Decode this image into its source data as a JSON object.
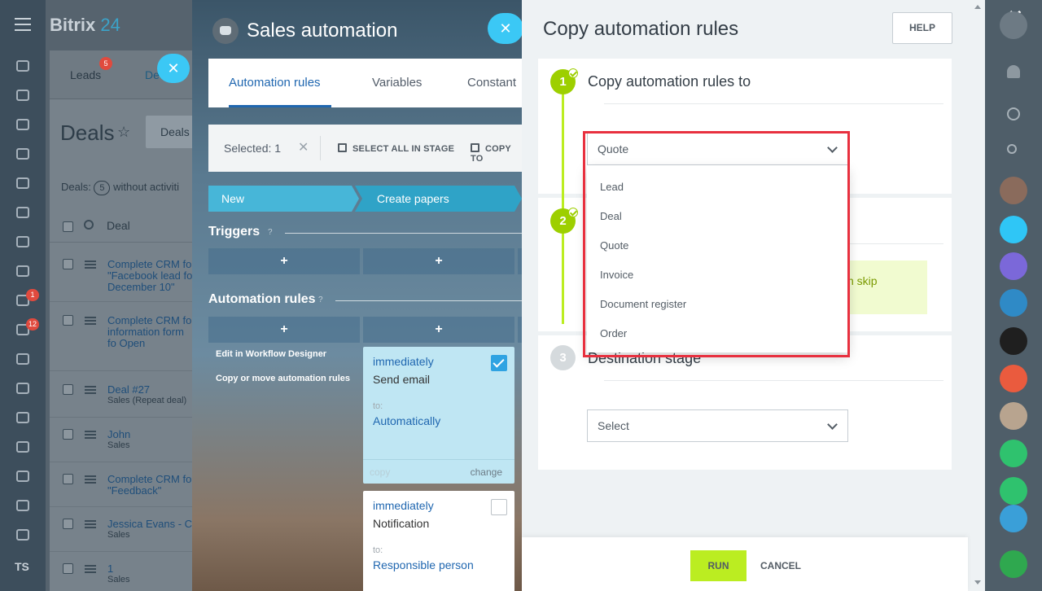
{
  "app": {
    "name": "Bitrix",
    "name_suffix": "24"
  },
  "crm": {
    "tabs": [
      {
        "label": "Leads",
        "badge": "5"
      },
      {
        "label": "De"
      }
    ],
    "page_title": "Deals",
    "filter_button": "Deals",
    "summary": {
      "prefix": "Deals:",
      "count": "5",
      "suffix": "without activiti"
    },
    "column_header": "Deal",
    "rows": [
      {
        "title": "Complete CRM fo \"Facebook lead fo December 10\"",
        "sub": ""
      },
      {
        "title": "Complete CRM fo information form fo Open Channels\"",
        "sub": ""
      },
      {
        "title": "Deal #27",
        "sub": "Sales (Repeat deal)"
      },
      {
        "title": "John",
        "sub": "Sales"
      },
      {
        "title": "Complete CRM fo \"Feedback\"",
        "sub": ""
      },
      {
        "title": "Jessica Evans - C",
        "sub": "Sales"
      },
      {
        "title": "1",
        "sub": "Sales"
      }
    ]
  },
  "nav": {
    "badges": {
      "tasks": "1",
      "feed": "12"
    },
    "user_initials": "TS"
  },
  "automation": {
    "title": "Sales automation",
    "tabs": [
      "Automation rules",
      "Variables",
      "Constant"
    ],
    "toolbar": {
      "selected": "Selected: 1",
      "select_all": "SELECT ALL IN STAGE",
      "copy_to": "COPY TO"
    },
    "stages": [
      "New",
      "Create papers"
    ],
    "triggers_label": "Triggers",
    "rules_label": "Automation rules",
    "help_mark": "?",
    "plus": "+",
    "links": [
      "Edit in Workflow Designer",
      "Copy or move automation rules"
    ],
    "cards": [
      {
        "when": "immediately",
        "name": "Send email",
        "to_label": "to:",
        "to_value": "Automatically",
        "copy": "copy",
        "change": "change",
        "checked": true
      },
      {
        "when": "immediately",
        "name": "Notification",
        "to_label": "to:",
        "to_value": "Responsible person",
        "checked": false
      }
    ]
  },
  "copy_panel": {
    "title": "Copy automation rules",
    "help": "HELP",
    "steps": [
      {
        "num": "1",
        "title": "Copy automation rules to",
        "select_value": "Quote"
      },
      {
        "num": "2",
        "title": "",
        "info_fragment": "n skip"
      },
      {
        "num": "3",
        "title": "Destination stage",
        "select_value": "Select"
      }
    ],
    "dropdown_options": [
      "Lead",
      "Deal",
      "Quote",
      "Invoice",
      "Document register",
      "Order"
    ],
    "run": "RUN",
    "cancel": "CANCEL"
  },
  "colors": {
    "accent_green": "#bbed21",
    "step_done": "#9dcf00",
    "highlight_frame": "#e8303f",
    "link_blue": "#2067b0",
    "close_bubble": "#3bc8f5"
  }
}
